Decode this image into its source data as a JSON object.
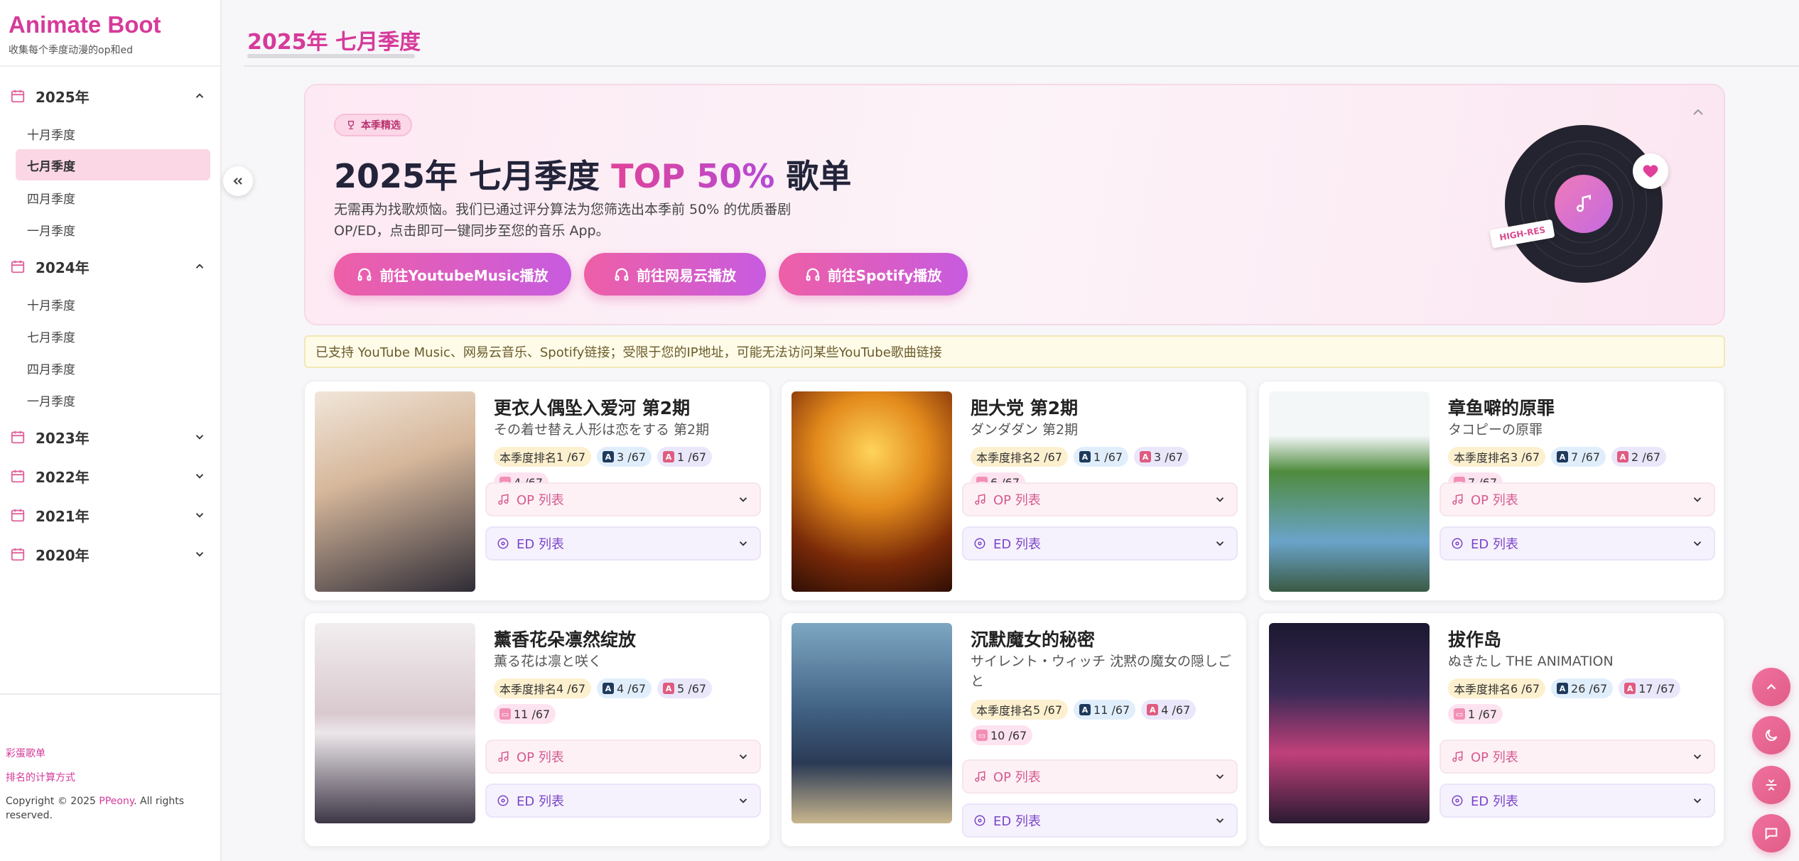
{
  "brand": {
    "title": "Animate Boot",
    "subtitle": "收集每个季度动漫的op和ed"
  },
  "sidebar": {
    "years": [
      {
        "label": "2025年",
        "expanded": true,
        "seasons": [
          "十月季度",
          "七月季度",
          "四月季度",
          "一月季度"
        ],
        "active": "七月季度"
      },
      {
        "label": "2024年",
        "expanded": true,
        "seasons": [
          "十月季度",
          "七月季度",
          "四月季度",
          "一月季度"
        ]
      },
      {
        "label": "2023年",
        "expanded": false
      },
      {
        "label": "2022年",
        "expanded": false
      },
      {
        "label": "2021年",
        "expanded": false
      },
      {
        "label": "2020年",
        "expanded": false
      }
    ],
    "footer": {
      "easter_egg": "彩蛋歌单",
      "ranking_method": "排名的计算方式",
      "copyright_prefix": "Copyright © 2025 ",
      "author": "PPeony",
      "copyright_suffix": ". All rights reserved."
    }
  },
  "header": {
    "title": "2025年 七月季度"
  },
  "hero": {
    "badge": "本季精选",
    "title_prefix": "2025年 七月季度 ",
    "title_accent": "TOP 50%",
    "title_suffix": " 歌单",
    "description": "无需再为找歌烦恼。我们已通过评分算法为您筛选出本季前 50% 的优质番剧 OP/ED，点击即可一键同步至您的音乐 App。",
    "buttons": [
      "前往YoutubeMusic播放",
      "前往网易云播放",
      "前往Spotify播放"
    ],
    "hires_label": "HIGH-RES"
  },
  "notice": "已支持 YouTube Music、网易云音乐、Spotify链接；受限于您的IP地址，可能无法访问某些YouTube歌曲链接",
  "list_labels": {
    "op": "OP 列表",
    "ed": "ED 列表",
    "rank_prefix": "本季度排名 "
  },
  "anime": [
    {
      "title": "更衣人偶坠入爱河 第2期",
      "subtitle": "その着せ替え人形は恋をする 第2期",
      "rank": "1 /67",
      "anilist": "3 /67",
      "mal": "1 /67",
      "bgm": "4 /67",
      "poster_colors": [
        "#e8d9c9",
        "#b58a6c",
        "#2b2b33"
      ]
    },
    {
      "title": "胆大党 第2期",
      "subtitle": "ダンダダン 第2期",
      "rank": "2 /67",
      "anilist": "1 /67",
      "mal": "3 /67",
      "bgm": "6 /67",
      "poster_colors": [
        "#f5b533",
        "#a54d13",
        "#3a1606"
      ]
    },
    {
      "title": "章鱼噼的原罪",
      "subtitle": "タコピーの原罪",
      "rank": "3 /67",
      "anilist": "7 /67",
      "mal": "2 /67",
      "bgm": "7 /67",
      "poster_colors": [
        "#eaf1f4",
        "#4d8a3c",
        "#273b2e"
      ]
    },
    {
      "title": "薰香花朵凛然绽放",
      "subtitle": "薫る花は凛と咲く",
      "rank": "4 /67",
      "anilist": "4 /67",
      "mal": "5 /67",
      "bgm": "11 /67",
      "poster_colors": [
        "#f0ecef",
        "#c4b2c4",
        "#3a3444"
      ]
    },
    {
      "title": "沉默魔女的秘密",
      "subtitle": "サイレント・ウィッチ 沈黙の魔女の隠しごと",
      "rank": "5 /67",
      "anilist": "11 /67",
      "mal": "4 /67",
      "bgm": "10 /67",
      "poster_colors": [
        "#5d87a8",
        "#2c3e5c",
        "#d9c7a6"
      ]
    },
    {
      "title": "拔作岛",
      "subtitle": "ぬきたし THE ANIMATION",
      "rank": "6 /67",
      "anilist": "26 /67",
      "mal": "17 /67",
      "bgm": "1 /67",
      "poster_colors": [
        "#1b1730",
        "#c03a6e",
        "#f2d6e4"
      ]
    }
  ],
  "colors": {
    "accent": "#d63a9a",
    "gradient_start": "#ee5fa6",
    "gradient_end": "#c75be0"
  }
}
